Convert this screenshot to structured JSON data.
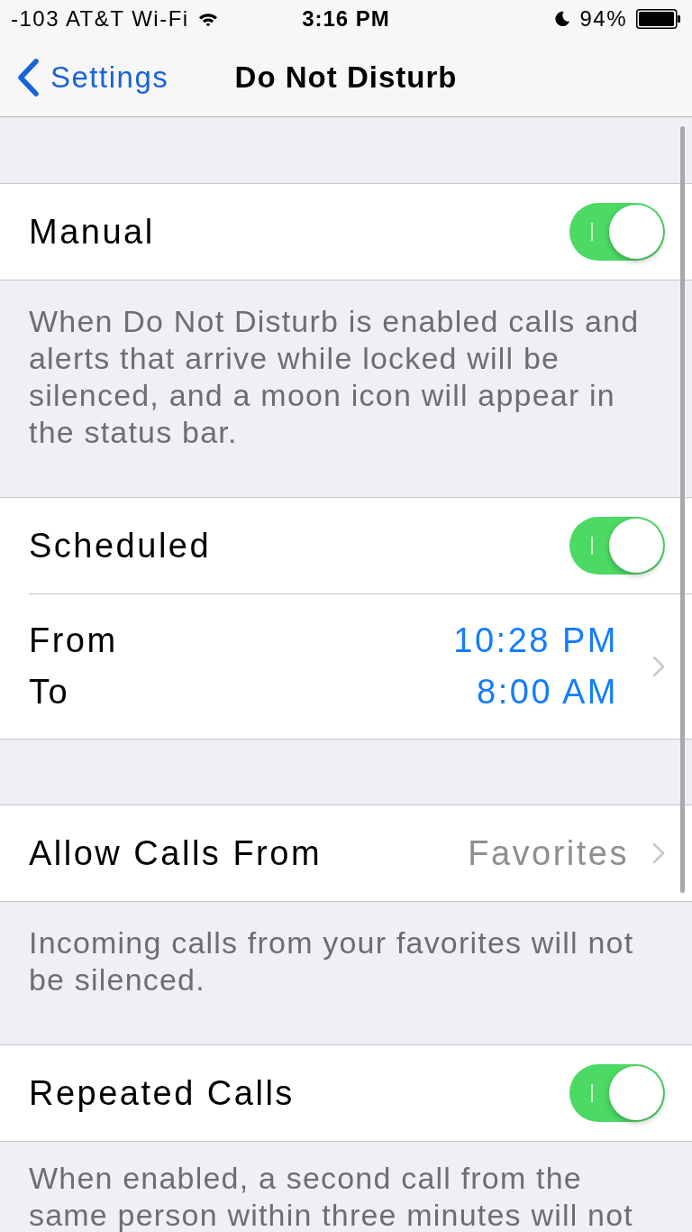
{
  "status_bar": {
    "carrier": "-103 AT&T Wi-Fi",
    "time": "3:16 PM",
    "battery": "94%"
  },
  "nav_bar": {
    "back": "Settings",
    "title": "Do Not Disturb"
  },
  "sections": [
    {
      "rows": [
        {
          "kind": "toggle",
          "label": "Manual",
          "on": true
        }
      ],
      "footer": "When Do Not Disturb is enabled calls and alerts that arrive while locked will be silenced, and a moon icon will appear in the status bar."
    },
    {
      "rows": [
        {
          "kind": "toggle",
          "label": "Scheduled",
          "on": true
        },
        {
          "kind": "times",
          "from_label": "From",
          "to_label": "To",
          "from": "10:28 PM",
          "to": "8:00 AM"
        }
      ]
    },
    {
      "rows": [
        {
          "kind": "value",
          "label": "Allow Calls From",
          "value": "Favorites"
        }
      ],
      "footer": "Incoming calls from your favorites will not be silenced."
    },
    {
      "rows": [
        {
          "kind": "toggle",
          "label": "Repeated Calls",
          "on": true
        }
      ],
      "footer": "When enabled, a second call from the same person within three minutes will not"
    }
  ]
}
